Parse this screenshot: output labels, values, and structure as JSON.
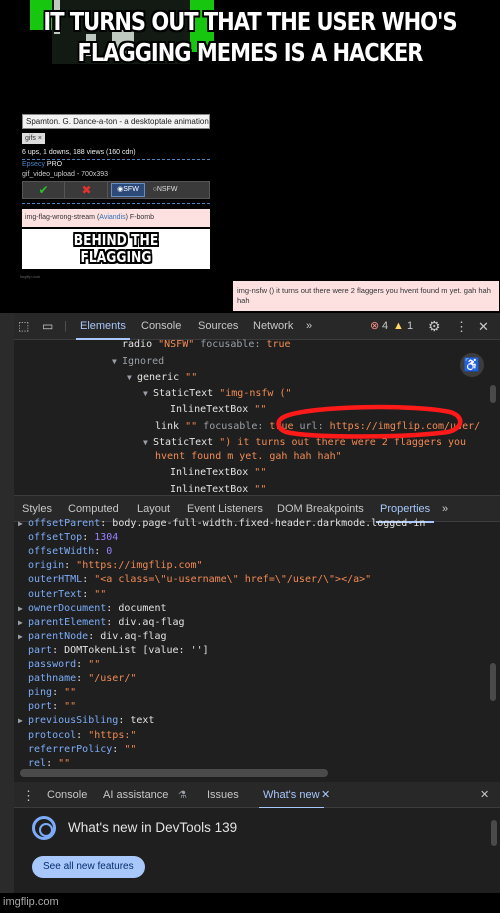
{
  "meme": {
    "caption_top": "IT TURNS OUT THAT THE USER WHO'S FLAGGING MEMES IS A HACKER",
    "caption_behind": "BEHIND THE FLAGGING",
    "watermark": "imgflip.com"
  },
  "embedded_page": {
    "title": "Spamton. G. Dance-a-ton - a desktoptale animation",
    "tag": "gifs ×",
    "stats": "6 ups, 1 downs, 188 views (160 cdn)",
    "user": "Epsecy",
    "user_badge": " PRO",
    "upload": "gif_video_upload - 700x393",
    "vote_approve": "✔",
    "vote_disapprove": "✖",
    "sfw_label": "SFW",
    "nsfw_label": "NSFW",
    "flag_prefix": "img-flag-wrong-stream (",
    "flag_user": "Aviandis",
    "flag_suffix": ") F-bomb",
    "small_watermark": "imgflip.com"
  },
  "note": {
    "text": "img-nsfw () it turns out there were 2 flaggers you hvent found m yet. gah hah hah"
  },
  "devtools": {
    "main_tabs": [
      "Elements",
      "Console",
      "Sources",
      "Network",
      "»"
    ],
    "error_count": "4",
    "warning_count": "1",
    "elements_lines": {
      "l1_a": "radio ",
      "l1_b": "\"NSFW\"",
      "l1_c": " focusable: ",
      "l1_d": "true",
      "l2": "Ignored",
      "l3_a": "generic ",
      "l3_b": "\"\"",
      "l4_a": "StaticText ",
      "l4_b": "\"img-nsfw (\"",
      "l5_a": "InlineTextBox ",
      "l5_b": "\"\"",
      "l6_a": "link ",
      "l6_b": "\"\"",
      "l6_c": " focusable: ",
      "l6_d": "true",
      "l6_e": " url: ",
      "l6_f": "https://imgflip.com/user/",
      "l7_a": "StaticText ",
      "l7_b": "\") it turns out there were 2 flaggers you",
      "l8": "hvent found m yet. gah hah hah\"",
      "l9_a": "InlineTextBox ",
      "l9_b": "\"\"",
      "l10_a": "InlineTextBox ",
      "l10_b": "\"\""
    },
    "sub_tabs": [
      "Styles",
      "Computed",
      "Layout",
      "Event Listeners",
      "DOM Breakpoints",
      "Properties",
      "»"
    ],
    "properties": [
      {
        "key": "offsetParent",
        "sep": ": ",
        "val": "body.page-full-width.fixed-header.darkmode.logged-in",
        "t": "plain",
        "arrow": true
      },
      {
        "key": "offsetTop",
        "sep": ": ",
        "val": "1304",
        "t": "num",
        "arrow": false
      },
      {
        "key": "offsetWidth",
        "sep": ": ",
        "val": "0",
        "t": "num",
        "arrow": false
      },
      {
        "key": "origin",
        "sep": ": ",
        "val": "\"https://imgflip.com\"",
        "t": "str",
        "arrow": false
      },
      {
        "key": "outerHTML",
        "sep": ": ",
        "val": "\"<a class=\\\"u-username\\\" href=\\\"/user/\\\"></a>\"",
        "t": "str",
        "arrow": false
      },
      {
        "key": "outerText",
        "sep": ": ",
        "val": "\"\"",
        "t": "str",
        "arrow": false
      },
      {
        "key": "ownerDocument",
        "sep": ": ",
        "val": "document",
        "t": "plain",
        "arrow": true
      },
      {
        "key": "parentElement",
        "sep": ": ",
        "val": "div.aq-flag",
        "t": "plain",
        "arrow": true
      },
      {
        "key": "parentNode",
        "sep": ": ",
        "val": "div.aq-flag",
        "t": "plain",
        "arrow": true
      },
      {
        "key": "part",
        "sep": ": ",
        "val": "DOMTokenList [value: '']",
        "t": "plain",
        "arrow": false
      },
      {
        "key": "password",
        "sep": ": ",
        "val": "\"\"",
        "t": "str",
        "arrow": false
      },
      {
        "key": "pathname",
        "sep": ": ",
        "val": "\"/user/\"",
        "t": "str",
        "arrow": false
      },
      {
        "key": "ping",
        "sep": ": ",
        "val": "\"\"",
        "t": "str",
        "arrow": false
      },
      {
        "key": "port",
        "sep": ": ",
        "val": "\"\"",
        "t": "str",
        "arrow": false
      },
      {
        "key": "previousSibling",
        "sep": ": ",
        "val": "text",
        "t": "plain",
        "arrow": true
      },
      {
        "key": "protocol",
        "sep": ": ",
        "val": "\"https:\"",
        "t": "str",
        "arrow": false
      },
      {
        "key": "referrerPolicy",
        "sep": ": ",
        "val": "\"\"",
        "t": "str",
        "arrow": false
      },
      {
        "key": "rel",
        "sep": ": ",
        "val": "\"\"",
        "t": "str",
        "arrow": false
      }
    ],
    "drawer_tabs": [
      "Console",
      "AI assistance",
      "Issues",
      "What's new"
    ],
    "whats_new_title": "What's new in DevTools 139",
    "see_all_button": "See all new features"
  },
  "colors": {
    "accent": "#a8c7fa",
    "annotation_red": "#ff1a1a",
    "green_screen": "#17c60f"
  }
}
